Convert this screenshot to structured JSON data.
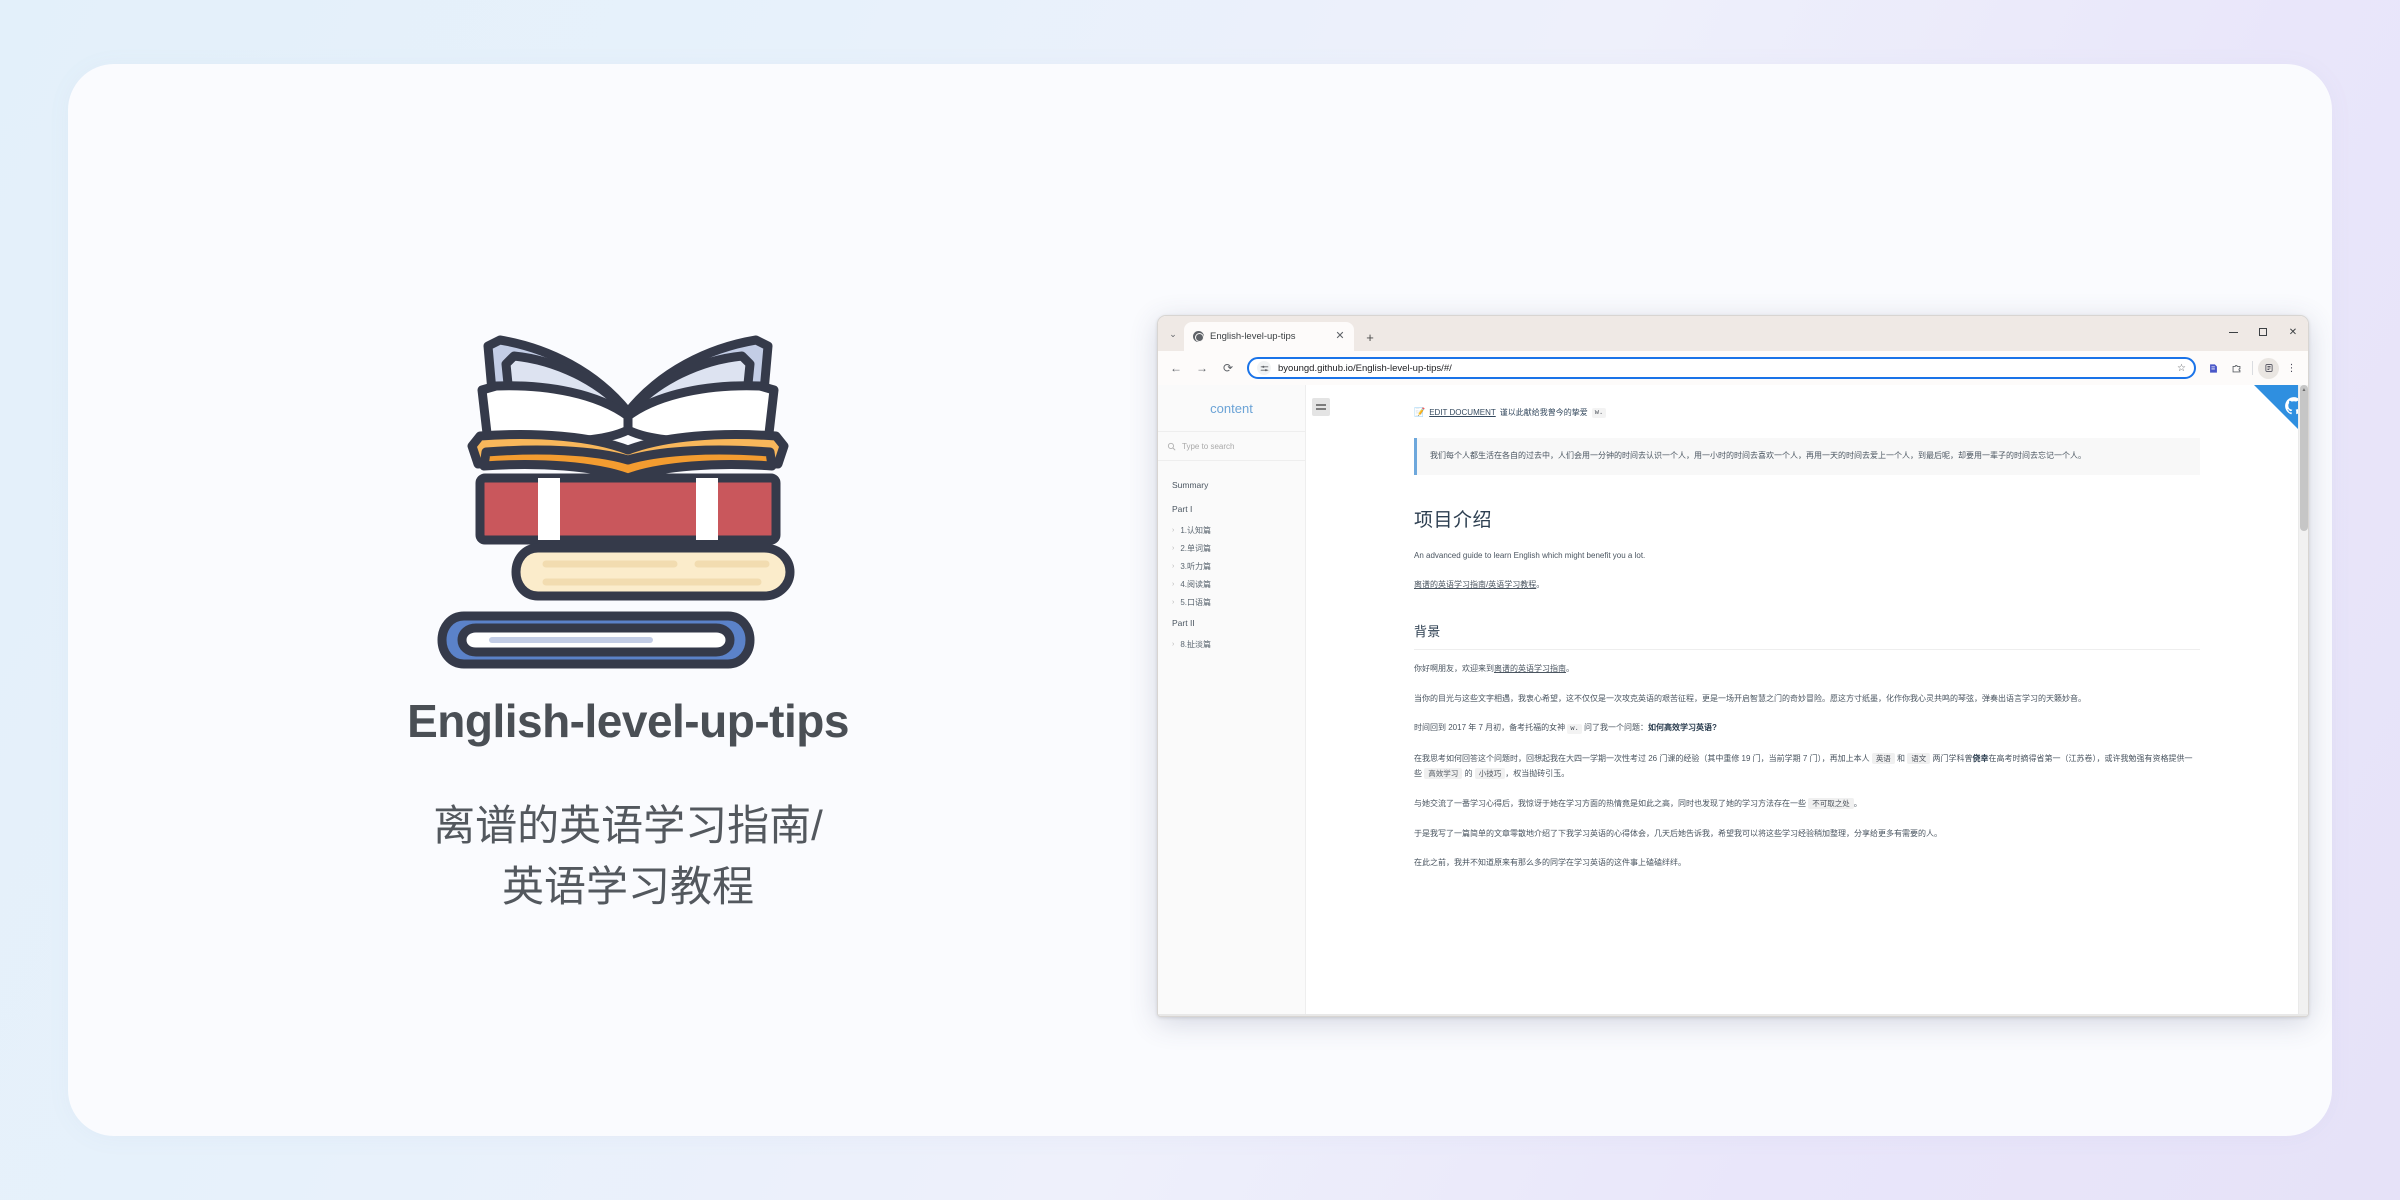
{
  "promo": {
    "title": "English-level-up-tips",
    "subtitle_line1": "离谱的英语学习指南/",
    "subtitle_line2": "英语学习教程",
    "illustration_name": "stack-of-books-illustration"
  },
  "browser": {
    "tab": {
      "title": "English-level-up-tips",
      "close_label": "✕",
      "favicon_name": "globe-favicon"
    },
    "new_tab_label": "+",
    "tab_list_chevron": "⌄",
    "window_controls": {
      "minimize": "—",
      "maximize": "▢",
      "close": "✕"
    },
    "toolbar": {
      "back": "←",
      "forward": "→",
      "reload": "⟳",
      "url": "byoungd.github.io/English-level-up-tips/#/",
      "star": "☆",
      "site_settings_icon": "tune-icon",
      "extensions_icon": "puzzle-icon",
      "bookmark_icon": "bookmark-edit-icon",
      "profile_icon": "profile-icon",
      "menu": "⋮"
    }
  },
  "sidebar": {
    "brand": "content",
    "search_placeholder": "Type to search",
    "sections": [
      {
        "label": "Summary",
        "items": []
      },
      {
        "label": "Part I",
        "items": [
          {
            "label": "1.认知篇"
          },
          {
            "label": "2.单词篇"
          },
          {
            "label": "3.听力篇"
          },
          {
            "label": "4.阅读篇"
          },
          {
            "label": "5.口语篇"
          }
        ]
      },
      {
        "label": "Part II",
        "items": [
          {
            "label": "8.扯淡篇"
          }
        ]
      }
    ],
    "caret": "›"
  },
  "content": {
    "hamburger_name": "sidebar-toggle",
    "edit_bar": {
      "pencil": "📝",
      "link_text": "EDIT DOCUMENT",
      "suffix": "谨以此献给我曾今的挚爱",
      "code": "w."
    },
    "quote": "我们每个人都生活在各自的过去中，人们会用一分钟的时间去认识一个人，用一小时的时间去喜欢一个人，再用一天的时间去爱上一个人，到最后呢，却要用一辈子的时间去忘记一个人。",
    "h1": "项目介绍",
    "intro_en": "An advanced guide to learn English which might benefit you a lot.",
    "intro_link": "离谱的英语学习指南/英语学习教程",
    "intro_link_suffix": "。",
    "h2": "背景",
    "p1_pre": "你好啊朋友，欢迎来到",
    "p1_link": "离谱的英语学习指南",
    "p1_post": "。",
    "p2": "当你的目光与这些文字相遇，我衷心希望，这不仅仅是一次攻克英语的艰苦征程，更是一场开启智慧之门的奇妙冒险。愿这方寸纸墨，化作你我心灵共鸣的琴弦，弹奏出语言学习的天籁妙音。",
    "p3_a": "时间回到 2017 年 7 月初，备考托福的女神",
    "p3_code": "w.",
    "p3_b": "问了我一个问题：",
    "p3_bold": "如何高效学习英语?",
    "p4_a": "在我思考如何回答这个问题时，回想起我在大四一学期一次性考过 26 门课的经验（其中重修 19 门，当前学期 7 门），再加上本人",
    "p4_c1": "英语",
    "p4_b": "和",
    "p4_c2": "语文",
    "p4_c": "两门学科曾",
    "p4_bold": "侥幸",
    "p4_d": "在高考时摘得省第一（江苏卷），或许我勉强有资格提供一些",
    "p4_c3": "高效学习",
    "p4_e": "的",
    "p4_c4": "小技巧",
    "p4_f": "，权当抛砖引玉。",
    "p5_a": "与她交流了一番学习心得后，我惊讶于她在学习方面的热情竟是如此之高，同时也发现了她的学习方法存在一些",
    "p5_c1": "不可取之处",
    "p5_b": "。",
    "p6": "于是我写了一篇简单的文章零散地介绍了下我学习英语的心得体会，几天后她告诉我，希望我可以将这些学习经验稍加整理，分享给更多有需要的人。",
    "p7": "在此之前，我并不知道原来有那么多的同学在学习英语的这件事上磕磕绊绊。",
    "ribbon_name": "fork-me-on-github-ribbon"
  },
  "colors": {
    "accent_blue": "#1a73e8",
    "brand_blue": "#6ba3d6",
    "ribbon_blue": "#2f8fe0",
    "quote_border": "#6ea8dc",
    "book_red": "#c9575c",
    "book_blue": "#5b82c9",
    "book_cream": "#fbeccb",
    "book_orange": "#f4a93f",
    "book_pages": "#c3cde6"
  }
}
